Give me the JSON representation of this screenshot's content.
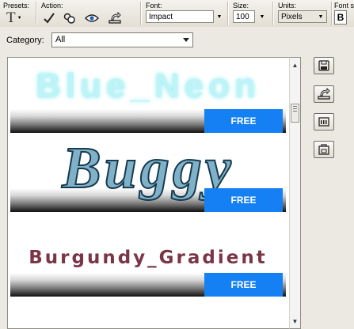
{
  "toolbar": {
    "presets_label": "Presets:",
    "action_label": "Action:",
    "font_label": "Font:",
    "font_value": "Impact",
    "size_label": "Size:",
    "size_value": "100",
    "units_label": "Units:",
    "units_value": "Pixels",
    "font_style_label": "Font s",
    "bold_glyph": "B",
    "text_tool_glyph": "T",
    "icons": [
      "text-tool-icon",
      "checkmark-icon",
      "styles-icon",
      "eye-icon",
      "load-icon"
    ]
  },
  "panel": {
    "category_label": "Category:",
    "category_value": "All",
    "items": [
      {
        "name": "Blue_Neon",
        "badge": "FREE"
      },
      {
        "name": "Buggy",
        "badge": "FREE"
      },
      {
        "name": "Burgundy_Gradient",
        "badge": "FREE"
      }
    ],
    "side_buttons": [
      "save-icon",
      "load-icon",
      "rename-icon",
      "delete-icon"
    ]
  },
  "colors": {
    "badge_bg": "#1580f3",
    "neon": "#bdf4f8",
    "buggy": "#7fb2c9",
    "burgundy": "#7a3547"
  }
}
